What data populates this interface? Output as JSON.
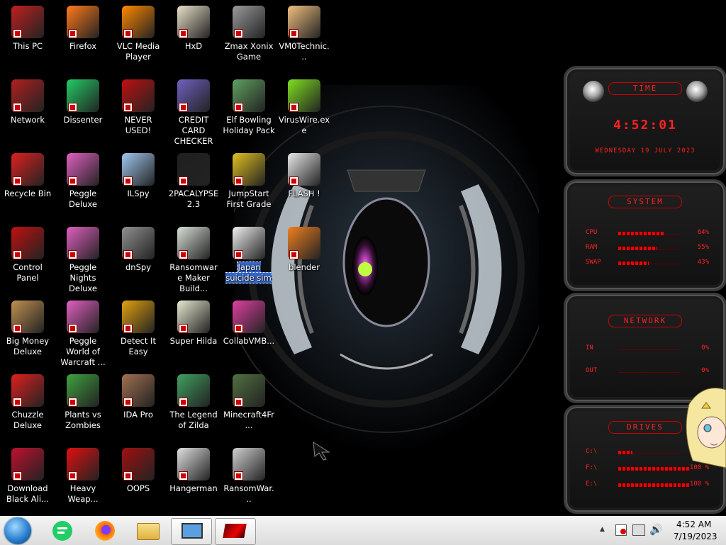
{
  "desktop": {
    "icons": [
      {
        "label": "This PC",
        "icon": "computer-icon",
        "color": "#c02020"
      },
      {
        "label": "Firefox",
        "icon": "firefox-icon",
        "color": "#ff7a1a"
      },
      {
        "label": "VLC Media Player",
        "icon": "vlc-icon",
        "color": "#ff8800"
      },
      {
        "label": "HxD",
        "icon": "hxd-icon",
        "color": "#e8e0c8"
      },
      {
        "label": "Zmax Xonix Game",
        "icon": "zmax-xonix-icon",
        "color": "#9a9a9a"
      },
      {
        "label": "VM0Technic...",
        "icon": "doctor-icon",
        "color": "#f0c080"
      },
      {
        "label": "Network",
        "icon": "network-icon",
        "color": "#b02020"
      },
      {
        "label": "Dissenter",
        "icon": "dissenter-icon",
        "color": "#22cc66"
      },
      {
        "label": "NEVER USED!",
        "icon": "devcpp-icon",
        "color": "#c01010"
      },
      {
        "label": "CREDIT CARD CHECKER",
        "icon": "credit-card-icon",
        "color": "#7060c0"
      },
      {
        "label": "Elf Bowling Holiday Pack",
        "icon": "elf-bowling-icon",
        "color": "#60a060"
      },
      {
        "label": "VirusWire.exe",
        "icon": "lime-icon",
        "color": "#80e020"
      },
      {
        "label": "Recycle Bin",
        "icon": "recycle-bin-icon",
        "color": "#e02020"
      },
      {
        "label": "Peggle Deluxe",
        "icon": "peggle-icon",
        "color": "#e060c0"
      },
      {
        "label": "ILSpy",
        "icon": "ilspy-icon",
        "color": "#a0c8f0"
      },
      {
        "label": "2PACALYPSE 2.3",
        "icon": "terminal-icon",
        "color": "#202020"
      },
      {
        "label": "JumpStart First Grade",
        "icon": "jumpstart-icon",
        "color": "#e0c020"
      },
      {
        "label": "FLASH !",
        "icon": "flash-icon",
        "color": "#e8e8e8"
      },
      {
        "label": "Control Panel",
        "icon": "control-panel-icon",
        "color": "#c01010"
      },
      {
        "label": "Peggle Nights Deluxe",
        "icon": "peggle-nights-icon",
        "color": "#e060c0"
      },
      {
        "label": "dnSpy",
        "icon": "dnspy-icon",
        "color": "#909090"
      },
      {
        "label": "Ransomware Maker Build...",
        "icon": "ransomware-maker-icon",
        "color": "#d8e0d8"
      },
      {
        "label": "Japan suicide sim",
        "icon": "file-icon",
        "color": "#f0f0f0"
      },
      {
        "label": "blender",
        "icon": "blender-icon",
        "color": "#f08020"
      },
      {
        "label": "Big Money Deluxe",
        "icon": "money-bag-icon",
        "color": "#c09050"
      },
      {
        "label": "Peggle World of Warcraft ...",
        "icon": "peggle-wow-icon",
        "color": "#e060c0"
      },
      {
        "label": "Detect It Easy",
        "icon": "detect-it-easy-icon",
        "color": "#e0a010"
      },
      {
        "label": "Super Hilda",
        "icon": "super-hilda-icon",
        "color": "#e8e8d0"
      },
      {
        "label": "CollabVMB...",
        "icon": "collabvm-icon",
        "color": "#e040a0"
      },
      {
        "label": "Chuzzle Deluxe",
        "icon": "chuzzle-icon",
        "color": "#e02020"
      },
      {
        "label": "Plants vs Zombies",
        "icon": "plants-vs-zombies-icon",
        "color": "#40a040"
      },
      {
        "label": "IDA Pro",
        "icon": "ida-pro-icon",
        "color": "#a07050"
      },
      {
        "label": "The Legend of Zilda",
        "icon": "zilda-icon",
        "color": "#40a060"
      },
      {
        "label": "Minecraft4Fr...",
        "icon": "minecraft-icon",
        "color": "#507040"
      },
      {
        "label": "Download Black Ali...",
        "icon": "black-alien-icon",
        "color": "#c01030"
      },
      {
        "label": "Heavy Weap...",
        "icon": "radiation-icon",
        "color": "#e01010"
      },
      {
        "label": "OOPS",
        "icon": "oops-icon",
        "color": "#a01010"
      },
      {
        "label": "Hangerman",
        "icon": "hangman-icon",
        "color": "#e0e0e0"
      },
      {
        "label": "RansomWar...",
        "icon": "skull-icon",
        "color": "#d0d0d0"
      }
    ]
  },
  "widgets": {
    "time": {
      "title": "TIME",
      "clock": "4:52:01",
      "date": "WEDNESDAY 19 JULY 2023"
    },
    "system": {
      "title": "SYSTEM",
      "rows": [
        {
          "label": "CPU",
          "value": "64%",
          "fill": 0.64
        },
        {
          "label": "RAM",
          "value": "55%",
          "fill": 0.55
        },
        {
          "label": "SWAP",
          "value": "43%",
          "fill": 0.43
        }
      ]
    },
    "network": {
      "title": "NETWORK",
      "rows": [
        {
          "label": "IN",
          "value": "0%"
        },
        {
          "label": "OUT",
          "value": "0%"
        }
      ]
    },
    "drives": {
      "title": "DRIVES",
      "rows": [
        {
          "label": "C:\\",
          "value": "",
          "fill": 0.2
        },
        {
          "label": "F:\\",
          "value": "100 %",
          "fill": 1.0
        },
        {
          "label": "E:\\",
          "value": "100 %",
          "fill": 1.0
        }
      ]
    }
  },
  "taskbar": {
    "clock_time": "4:52 AM",
    "clock_date": "7/19/2023",
    "show_hidden_icons": "▲"
  },
  "colors": {
    "accent_red": "#ff2020",
    "taskbar_bg": "#e6e6e6",
    "selection": "#3366cc"
  }
}
